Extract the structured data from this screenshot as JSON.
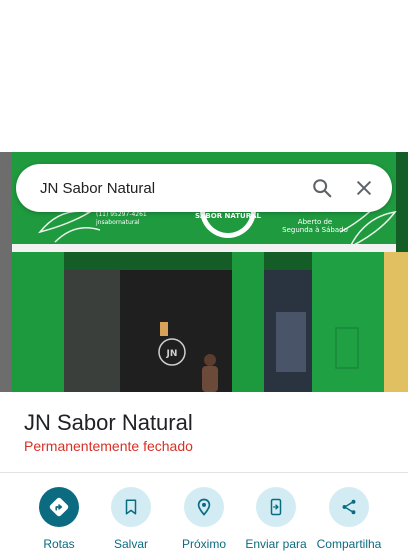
{
  "search": {
    "query": "JN Sabor Natural",
    "search_icon": "search-icon",
    "close_icon": "close-icon"
  },
  "photo": {
    "sign_brand": "SABOR NATURAL",
    "sign_contact": "(11) 95297-4261",
    "sign_social": "jnsabornatural",
    "sign_hours_line1": "Aberto de",
    "sign_hours_line2": "Segunda à Sábado",
    "logo_text": "JN"
  },
  "place": {
    "name": "JN Sabor Natural",
    "status": "Permanentemente fechado"
  },
  "actions": [
    {
      "label": "Rotas",
      "icon": "directions-icon"
    },
    {
      "label": "Salvar",
      "icon": "bookmark-icon"
    },
    {
      "label": "Próximo",
      "icon": "nearby-icon"
    },
    {
      "label": "Enviar para",
      "icon": "send-to-phone-icon"
    },
    {
      "label": "Compartilha",
      "icon": "share-icon"
    }
  ],
  "colors": {
    "accent": "#0b6b80",
    "action_bg": "#d3ecf4",
    "status_closed": "#d93025",
    "storefront_green": "#1e9a3e"
  }
}
